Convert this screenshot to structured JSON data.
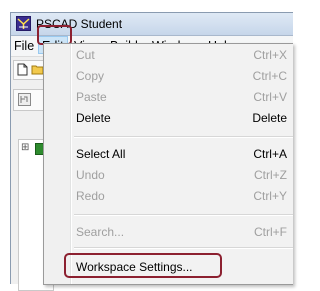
{
  "window": {
    "title": "PSCAD Student",
    "app_icon": "pscad-icon"
  },
  "menubar": {
    "items": [
      "File",
      "Edit",
      "View",
      "Build",
      "Window",
      "Help"
    ]
  },
  "toolbar": {
    "icons": [
      "new-file-icon",
      "open-folder-icon",
      "workspace-icon"
    ]
  },
  "tree": {
    "expander": "⊞"
  },
  "edit_menu": {
    "items": [
      {
        "label": "Cut",
        "shortcut": "Ctrl+X",
        "enabled": false
      },
      {
        "label": "Copy",
        "shortcut": "Ctrl+C",
        "enabled": false
      },
      {
        "label": "Paste",
        "shortcut": "Ctrl+V",
        "enabled": false
      },
      {
        "label": "Delete",
        "shortcut": "Delete",
        "enabled": true
      },
      {
        "label": "Select All",
        "shortcut": "Ctrl+A",
        "enabled": true
      },
      {
        "label": "Undo",
        "shortcut": "Ctrl+Z",
        "enabled": false
      },
      {
        "label": "Redo",
        "shortcut": "Ctrl+Y",
        "enabled": false
      },
      {
        "label": "Search...",
        "shortcut": "Ctrl+F",
        "enabled": false
      },
      {
        "label": "Workspace Settings...",
        "shortcut": "",
        "enabled": true
      }
    ]
  },
  "colors": {
    "highlight": "#8c2030",
    "menu_active": "#cce4f7"
  }
}
